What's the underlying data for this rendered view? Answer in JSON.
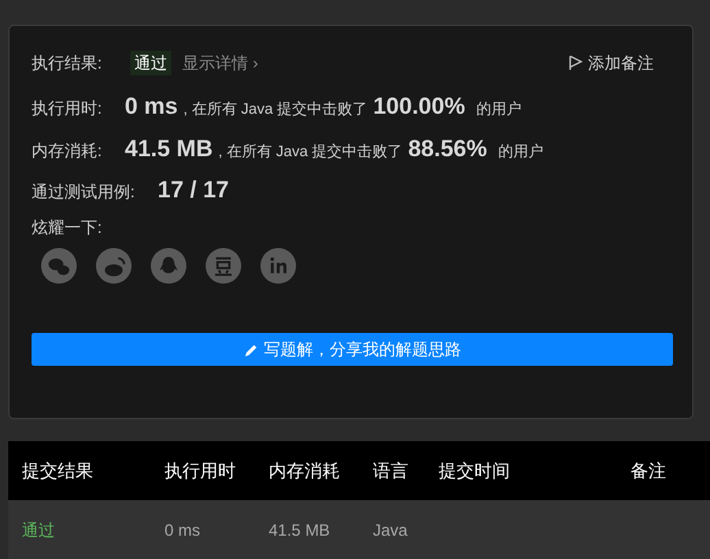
{
  "result": {
    "label": "执行结果:",
    "status": "通过",
    "details_link": "显示详情 ›",
    "add_note": "添加备注"
  },
  "stats": [
    {
      "label": "执行用时:",
      "value": "0 ms",
      "middle": ", 在所有 Java 提交中击败了",
      "percent": "100.00%",
      "suffix": "的用户"
    },
    {
      "label": "内存消耗:",
      "value": "41.5 MB",
      "middle": ", 在所有 Java 提交中击败了",
      "percent": "88.56%",
      "suffix": "的用户"
    }
  ],
  "tests": {
    "label": "通过测试用例:",
    "value": "17 / 17"
  },
  "share": {
    "label": "炫耀一下:",
    "icons": [
      {
        "kind": "wechat"
      },
      {
        "kind": "weibo"
      },
      {
        "kind": "qq"
      },
      {
        "kind": "douban"
      },
      {
        "kind": "linkedin"
      }
    ]
  },
  "write_button": "写题解，分享我的解题思路",
  "table": {
    "columns": [
      "提交结果",
      "执行用时",
      "内存消耗",
      "语言",
      "提交时间",
      "备注"
    ],
    "rows": [
      {
        "result": "通过",
        "time": "0 ms",
        "memory": "41.5 MB",
        "language": "Java"
      }
    ]
  }
}
